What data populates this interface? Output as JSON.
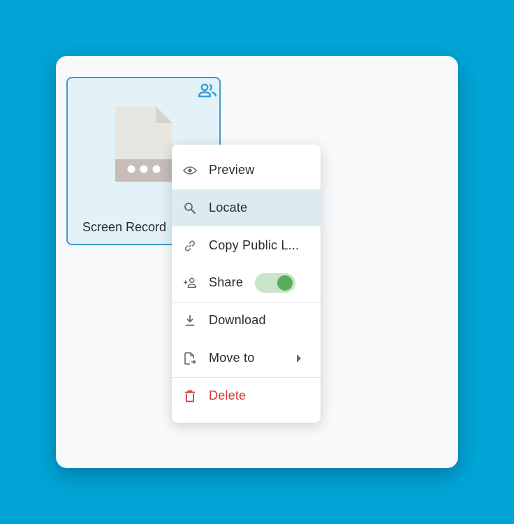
{
  "file": {
    "name": "Screen Recording",
    "name_visible": "Screen Record",
    "shared": true,
    "type_icon": "video-file-icon"
  },
  "context_menu": {
    "items": [
      {
        "label": "Preview",
        "icon": "eye-icon"
      },
      {
        "label": "Locate",
        "icon": "search-icon",
        "active": true
      },
      {
        "label": "Copy Public L...",
        "icon": "link-icon"
      },
      {
        "label": "Share",
        "icon": "add-person-icon",
        "toggle_on": true
      },
      {
        "label": "Download",
        "icon": "download-icon"
      },
      {
        "label": "Move to",
        "icon": "move-file-icon",
        "has_submenu": true
      },
      {
        "label": "Delete",
        "icon": "trash-icon",
        "danger": true
      }
    ]
  },
  "colors": {
    "background": "#00a5d6",
    "selection_border": "#3d9bcf",
    "toggle_on": "#5aac5a",
    "danger": "#d13a2f",
    "active_item": "#dcebf1"
  }
}
